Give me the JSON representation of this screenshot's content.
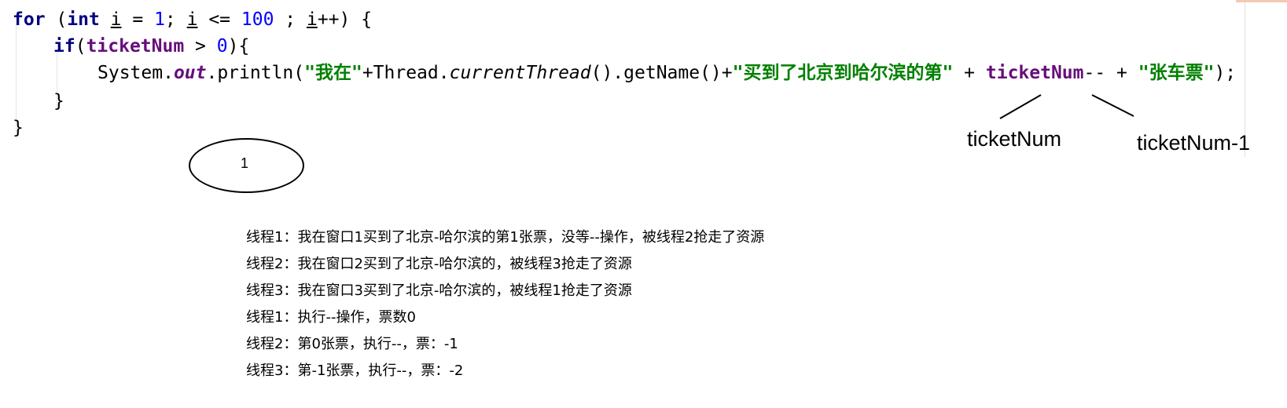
{
  "code": {
    "line1": {
      "kw_for": "for",
      "open": " (",
      "kw_int": "int",
      "sp1": " ",
      "var_i1": "i",
      "eq": " = ",
      "one": "1",
      "semi1": "; ",
      "var_i2": "i",
      "le": " <= ",
      "hundred": "100",
      "semi2": " ; ",
      "var_i3": "i",
      "inc": "++) {"
    },
    "line2": {
      "kw_if": "if",
      "open": "(",
      "field": "ticketNum",
      "gt": " > ",
      "zero": "0",
      "close": "){"
    },
    "line3": {
      "system": "System.",
      "out": "out",
      "println": ".println(",
      "str1": "\"我在\"",
      "plus1": "+Thread.",
      "current": "currentThread",
      "getname": "().getName()+",
      "str2": "\"买到了北京到哈尔滨的第\"",
      "plus2": " + ",
      "field": "ticketNum",
      "dec": "-- + ",
      "str3": "\"张车票\"",
      "end": ");"
    },
    "line4": "}",
    "line5": "}"
  },
  "annotations": {
    "label_left": "ticketNum",
    "label_right": "ticketNum-1",
    "ellipse_label": "1"
  },
  "notes": [
    "线程1：我在窗口1买到了北京-哈尔滨的第1张票，没等--操作，被线程2抢走了资源",
    "线程2：我在窗口2买到了北京-哈尔滨的，被线程3抢走了资源",
    "线程3：我在窗口3买到了北京-哈尔滨的，被线程1抢走了资源",
    "线程1：执行--操作，票数0",
    "线程2：第0张票，执行--，票：-1",
    "线程3：第-1张票，执行--，票：-2"
  ],
  "colors": {
    "keyword": "#000080",
    "number": "#0000ff",
    "field": "#660e7a",
    "string": "#008000"
  }
}
